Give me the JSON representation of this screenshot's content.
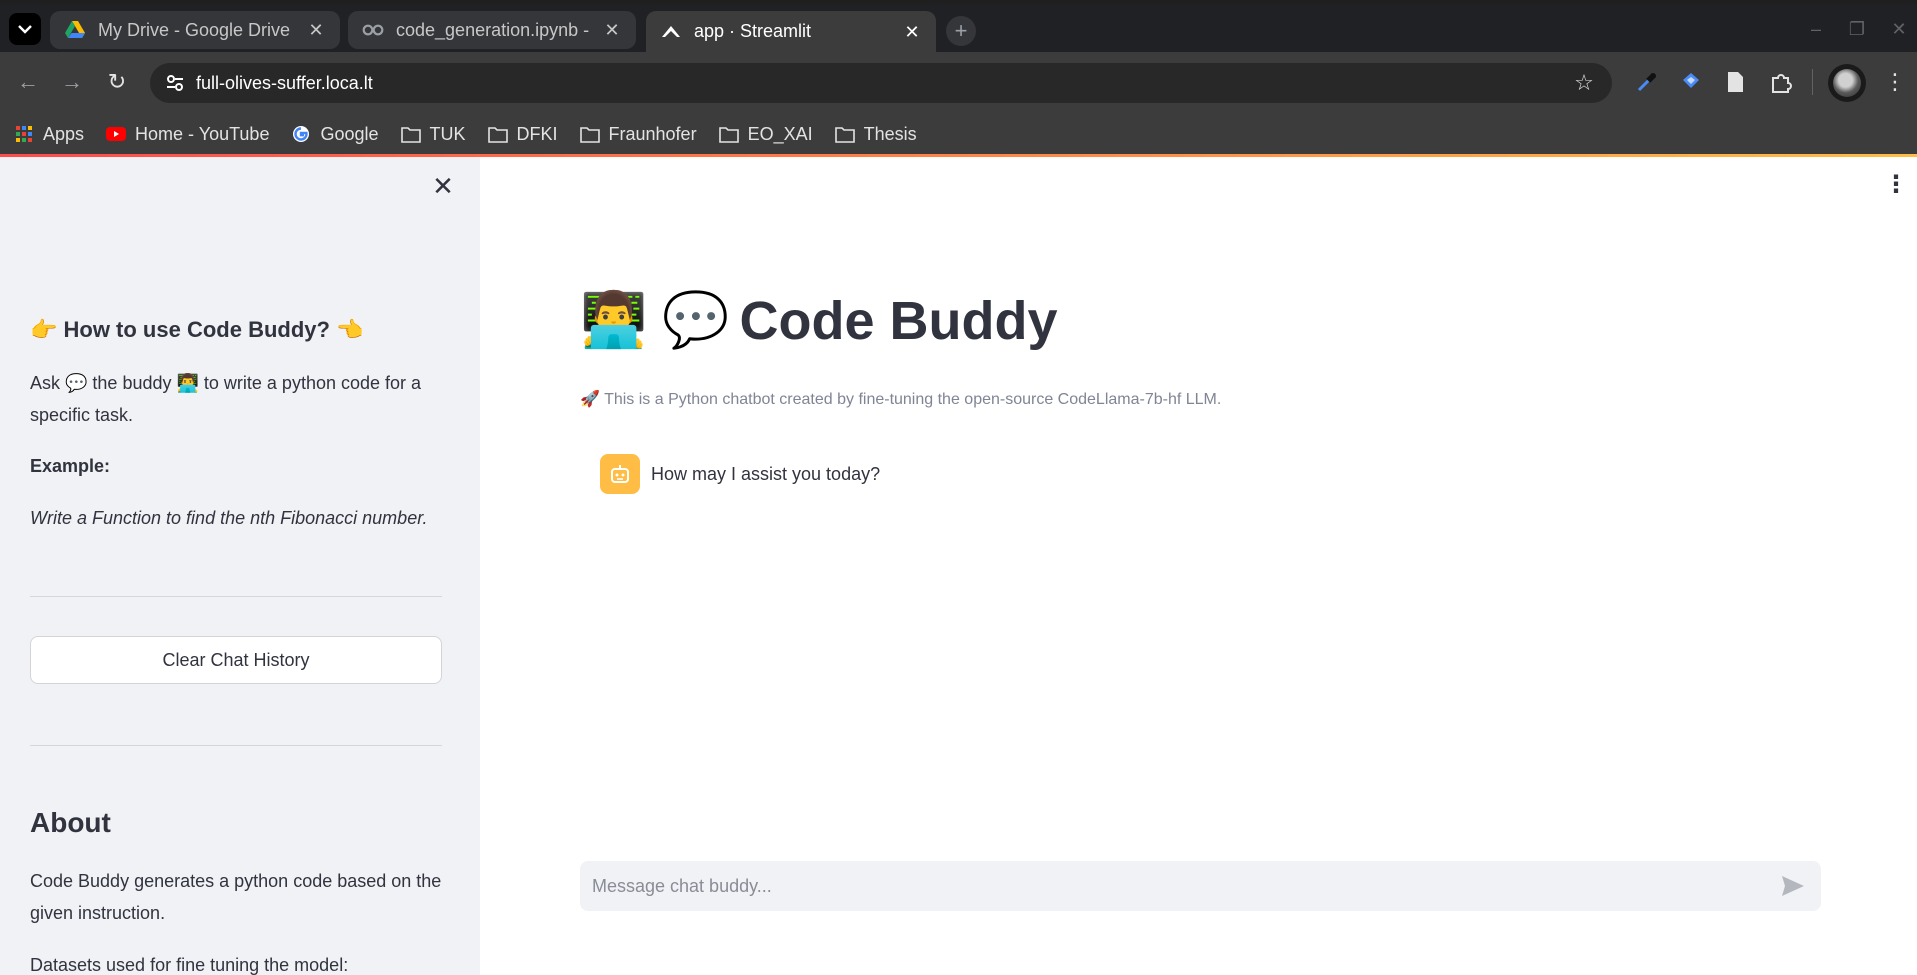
{
  "browser": {
    "tabs": [
      {
        "title": "My Drive - Google Drive",
        "icon": "google-drive-icon",
        "active": false
      },
      {
        "title": "code_generation.ipynb -",
        "icon": "colab-icon",
        "active": false
      },
      {
        "title": "app · Streamlit",
        "icon": "streamlit-icon",
        "active": true
      }
    ],
    "url": "full-olives-suffer.loca.lt",
    "bookmarks": [
      {
        "label": "Apps",
        "icon": "apps-grid-icon"
      },
      {
        "label": "Home - YouTube",
        "icon": "youtube-icon"
      },
      {
        "label": "Google",
        "icon": "google-icon"
      },
      {
        "label": "TUK",
        "icon": "folder-icon"
      },
      {
        "label": "DFKI",
        "icon": "folder-icon"
      },
      {
        "label": "Fraunhofer",
        "icon": "folder-icon"
      },
      {
        "label": "EO_XAI",
        "icon": "folder-icon"
      },
      {
        "label": "Thesis",
        "icon": "folder-icon"
      }
    ],
    "accent_decoration": [
      "#ff4b4b",
      "#ffbd45"
    ]
  },
  "sidebar": {
    "how_to_heading": "👉 How to use Code Buddy? 👈",
    "how_to_text": "Ask 💬 the buddy 👨‍💻 to write a python code for a specific task.",
    "example_label": "Example:",
    "example_text": "Write a Function to find the nth Fibonacci number.",
    "clear_button": "Clear Chat History",
    "about_heading": "About",
    "about_text": "Code Buddy generates a python code based on the given instruction.",
    "datasets_text": "Datasets used for fine tuning the model:"
  },
  "main": {
    "title_emoji": "👨‍💻 💬",
    "title": "Code Buddy",
    "caption": "🚀 This is a Python chatbot created by fine-tuning the open-source CodeLlama-7b-hf LLM.",
    "messages": [
      {
        "role": "assistant",
        "text": "How may I assist you today?"
      }
    ],
    "chat_input_placeholder": "Message chat buddy..."
  }
}
